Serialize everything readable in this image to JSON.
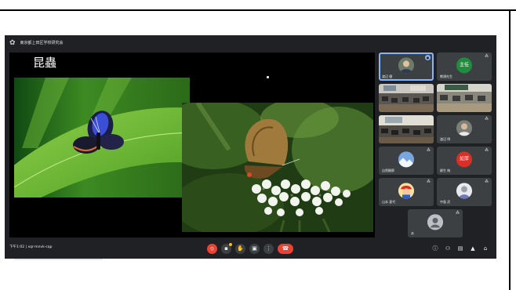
{
  "window": {
    "title": "東京都上田区学校研究会"
  },
  "slide": {
    "title": "昆蟲"
  },
  "participants": [
    {
      "name": "渡辺 健",
      "mic": "on",
      "kind": "camera-person"
    },
    {
      "name": "教頭先生",
      "mic": "off",
      "kind": "avatar",
      "initials": "主任",
      "color": "#1e8e3e"
    },
    {
      "name": "",
      "mic": "",
      "kind": "classroom"
    },
    {
      "name": "",
      "mic": "",
      "kind": "classroom"
    },
    {
      "name": "",
      "mic": "",
      "kind": "classroom"
    },
    {
      "name": "渡辺 明",
      "mic": "off",
      "kind": "camera-person"
    },
    {
      "name": "自然観察",
      "mic": "off",
      "kind": "avatar-image",
      "color": "#5f8bd0"
    },
    {
      "name": "柳生 純",
      "mic": "off",
      "kind": "avatar",
      "initials": "如萍",
      "color": "#d93025"
    },
    {
      "name": "山本 夏代",
      "mic": "off",
      "kind": "avatar-image",
      "color": "#f6b93b"
    },
    {
      "name": "中島 武",
      "mic": "off",
      "kind": "avatar-image",
      "color": "#9aa0a6"
    },
    {
      "name": "あ",
      "mic": "off",
      "kind": "avatar-generic",
      "color": "#bdc1c6"
    }
  ],
  "bottom_bar": {
    "meeting_info": "下午1:02  |  xqr-mnvk-cqp"
  },
  "colors": {
    "meet_background": "#202124",
    "tile_background": "#3c4043",
    "hangup_red": "#ea4335",
    "active_outline": "#8ab4f8"
  },
  "icons": {
    "controls": [
      "microphone-icon",
      "camera-icon",
      "raise-hand-icon",
      "present-icon",
      "more-options-icon",
      "hang-up-icon"
    ],
    "right_controls": [
      "info-icon",
      "people-icon",
      "chat-icon",
      "activities-icon",
      "host-controls-icon"
    ]
  }
}
